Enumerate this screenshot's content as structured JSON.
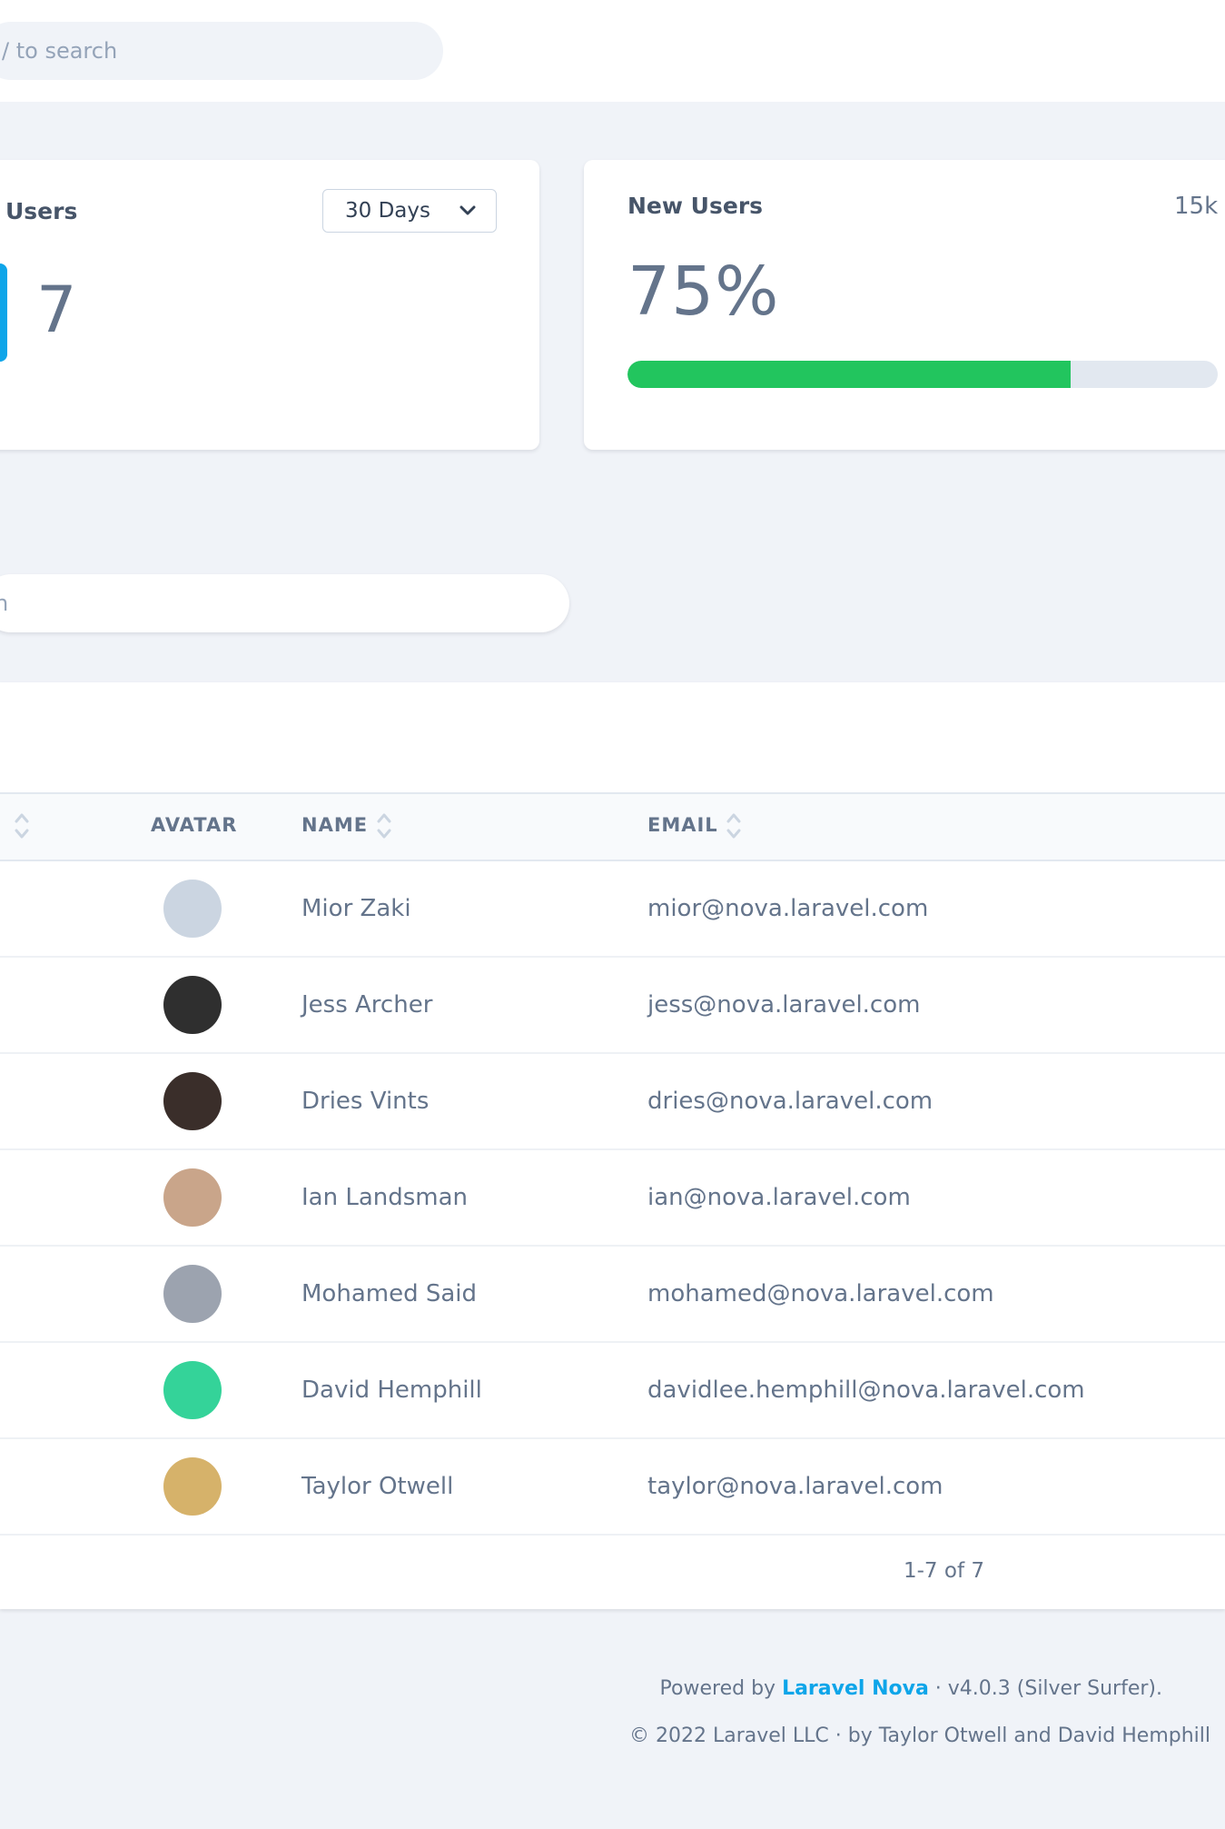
{
  "header": {
    "search_placeholder": "/ to search"
  },
  "metrics": {
    "users": {
      "title": "Users",
      "range": "30 Days",
      "value": "7"
    },
    "new_users": {
      "title": "New Users",
      "total": "15k",
      "percent_label": "75%",
      "progress": 0.75
    }
  },
  "resource_search": {
    "placeholder": "h"
  },
  "table": {
    "columns": {
      "avatar": "AVATAR",
      "name": "NAME",
      "email": "EMAIL"
    },
    "rows": [
      {
        "name": "Mior Zaki",
        "email": "mior@nova.laravel.com",
        "avatar_color": "#cbd5e1"
      },
      {
        "name": "Jess Archer",
        "email": "jess@nova.laravel.com",
        "avatar_color": "#2f2f2f"
      },
      {
        "name": "Dries Vints",
        "email": "dries@nova.laravel.com",
        "avatar_color": "#3a2e2a"
      },
      {
        "name": "Ian Landsman",
        "email": "ian@nova.laravel.com",
        "avatar_color": "#c9a58a"
      },
      {
        "name": "Mohamed Said",
        "email": "mohamed@nova.laravel.com",
        "avatar_color": "#9ca3af"
      },
      {
        "name": "David Hemphill",
        "email": "davidlee.hemphill@nova.laravel.com",
        "avatar_color": "#34d399"
      },
      {
        "name": "Taylor Otwell",
        "email": "taylor@nova.laravel.com",
        "avatar_color": "#d6b26a"
      }
    ],
    "pagination": "1-7 of 7"
  },
  "footer": {
    "powered_prefix": "Powered by ",
    "brand": "Laravel Nova",
    "version": " · v4.0.3 (Silver Surfer).",
    "copyright": "© 2022 Laravel LLC · by Taylor Otwell and David Hemphill"
  },
  "colors": {
    "accent": "#0ea5e9",
    "progress": "#22c55e"
  }
}
